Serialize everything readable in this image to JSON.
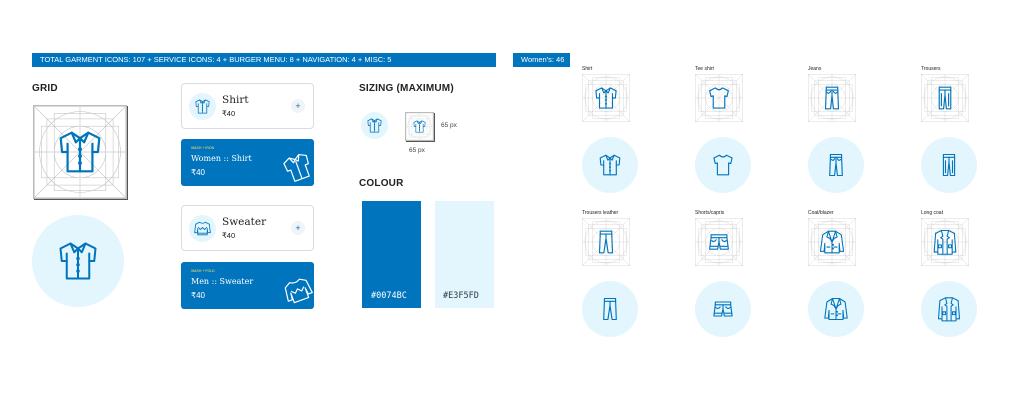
{
  "banner_totals": "TOTAL GARMENT ICONS: 107 + SERVICE ICONS: 4 + BURGER MENU: 8 + NAVIGATION: 4 + MISC: 5",
  "banner_womens": "Women's: 46",
  "grid": {
    "heading": "GRID"
  },
  "cards": {
    "shirt": {
      "title": "Shirt",
      "price": "₹40",
      "add": "+"
    },
    "women_shirt": {
      "tag": "WASH + IRON",
      "title": "Women :: Shirt",
      "price": "₹40"
    },
    "sweater": {
      "title": "Sweater",
      "price": "₹40",
      "add": "+"
    },
    "men_sweater": {
      "tag": "WASH + FOLD",
      "title": "Men :: Sweater",
      "price": "₹40"
    }
  },
  "sizing": {
    "heading": "SIZING (MAXIMUM)",
    "width_label": "65 px",
    "height_label": "65 px"
  },
  "colour": {
    "heading": "COLOUR",
    "primary_hex": "#0074BC",
    "secondary_hex": "#E3F5FD",
    "primary": "#0074BC",
    "secondary": "#E3F5FD"
  },
  "icons": [
    {
      "label": "Shirt",
      "icon": "shirt-icon"
    },
    {
      "label": "Tee shirt",
      "icon": "tshirt-icon"
    },
    {
      "label": "Jeans",
      "icon": "jeans-icon"
    },
    {
      "label": "Trousers",
      "icon": "trousers-icon"
    },
    {
      "label": "Trousers leather",
      "icon": "trousers-leather-icon"
    },
    {
      "label": "Shorts/capris",
      "icon": "shorts-icon"
    },
    {
      "label": "Coat/blazer",
      "icon": "blazer-icon"
    },
    {
      "label": "Long coat",
      "icon": "long-coat-icon"
    }
  ]
}
